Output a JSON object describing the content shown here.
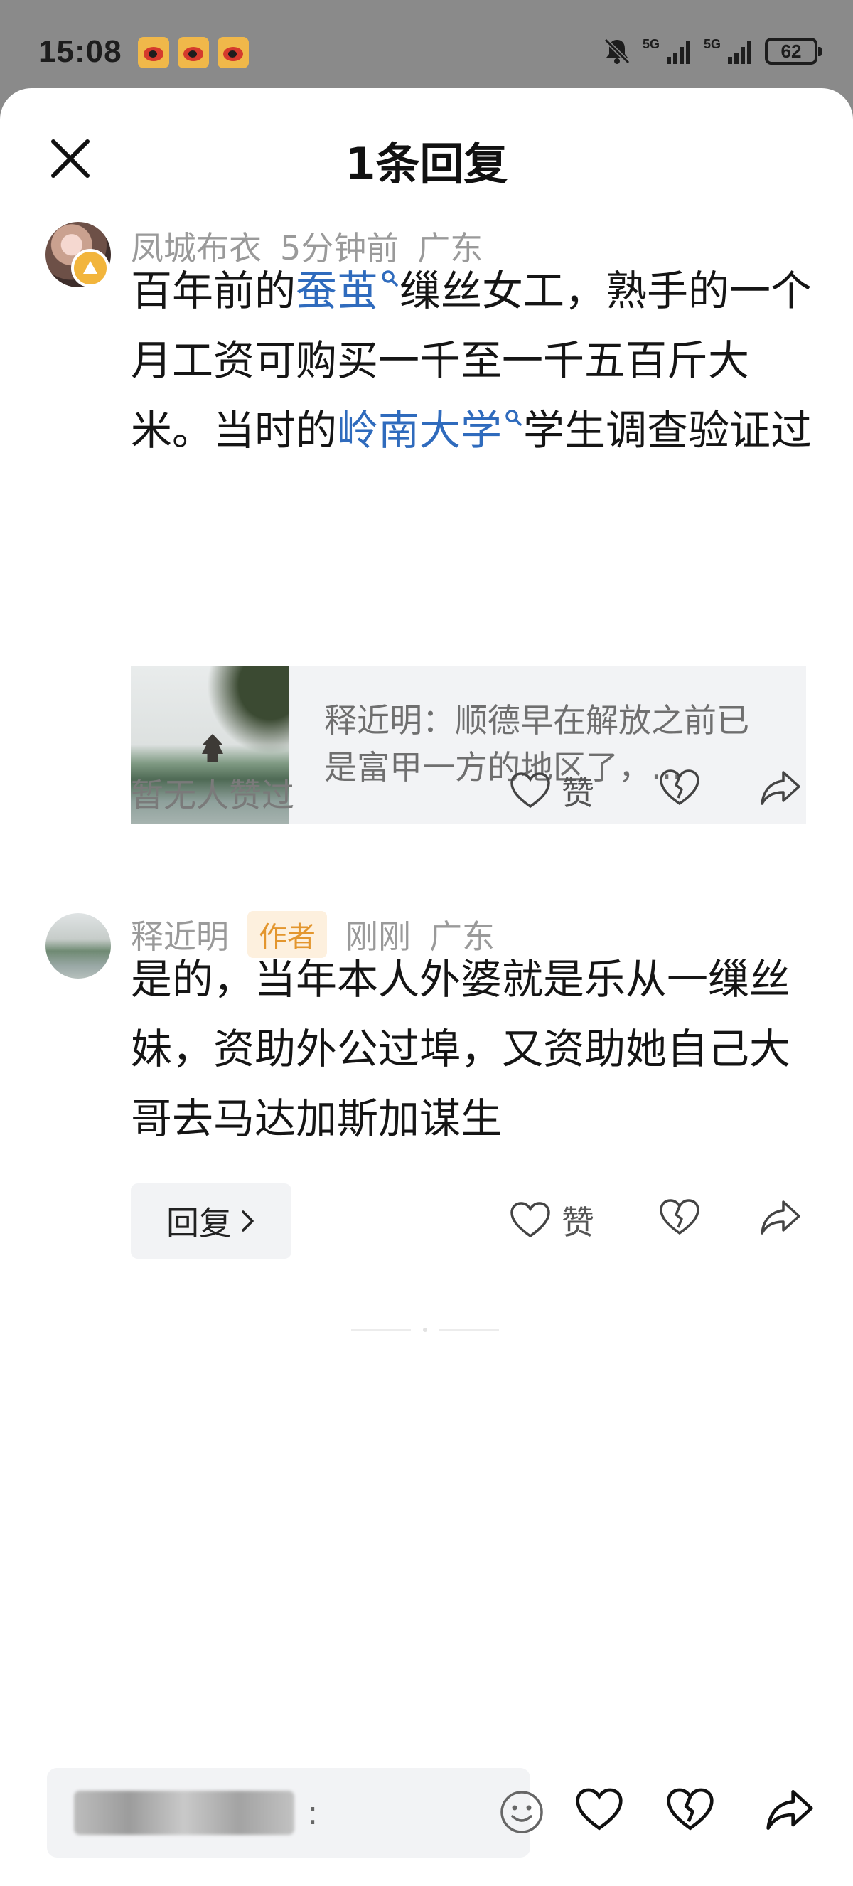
{
  "status_bar": {
    "time": "15:08",
    "network_1": "5G",
    "network_2": "5G",
    "battery": "62"
  },
  "sheet": {
    "title": "1条回复"
  },
  "comments": [
    {
      "user": "凤城布衣",
      "time": "5分钟前",
      "location": "广东",
      "text_parts": [
        "百年前的",
        "蚕茧",
        "缫丝女工，熟手的一个月工资可购买一千至一千五百斤大米。当时的",
        "岭南大学",
        "学生调查验证过"
      ],
      "quote": "释近明：顺德早在解放之前已是富甲一方的地区了，...",
      "likes_text": "暂无人赞过",
      "like_label": "赞"
    },
    {
      "user": "释近明",
      "author_tag": "作者",
      "time": "刚刚",
      "location": "广东",
      "text": "是的，当年本人外婆就是乐从一缫丝妹，资助外公过埠，又资助她自己大哥去马达加斯加谋生",
      "reply_label": "回复",
      "like_label": "赞"
    }
  ],
  "input": {
    "suffix": ":"
  },
  "colors": {
    "link": "#2f6bbd",
    "author_tag_text": "#e3962e",
    "author_tag_bg": "#fdf0de",
    "meta_gray": "#9a9a9a",
    "card_bg": "#f2f3f5"
  },
  "icons": [
    "weibo-icon",
    "bell-muted-icon",
    "signal-icon",
    "battery-icon",
    "close-icon",
    "search-icon",
    "heart-icon",
    "broken-heart-icon",
    "share-icon",
    "chevron-right-icon",
    "emoji-icon"
  ]
}
